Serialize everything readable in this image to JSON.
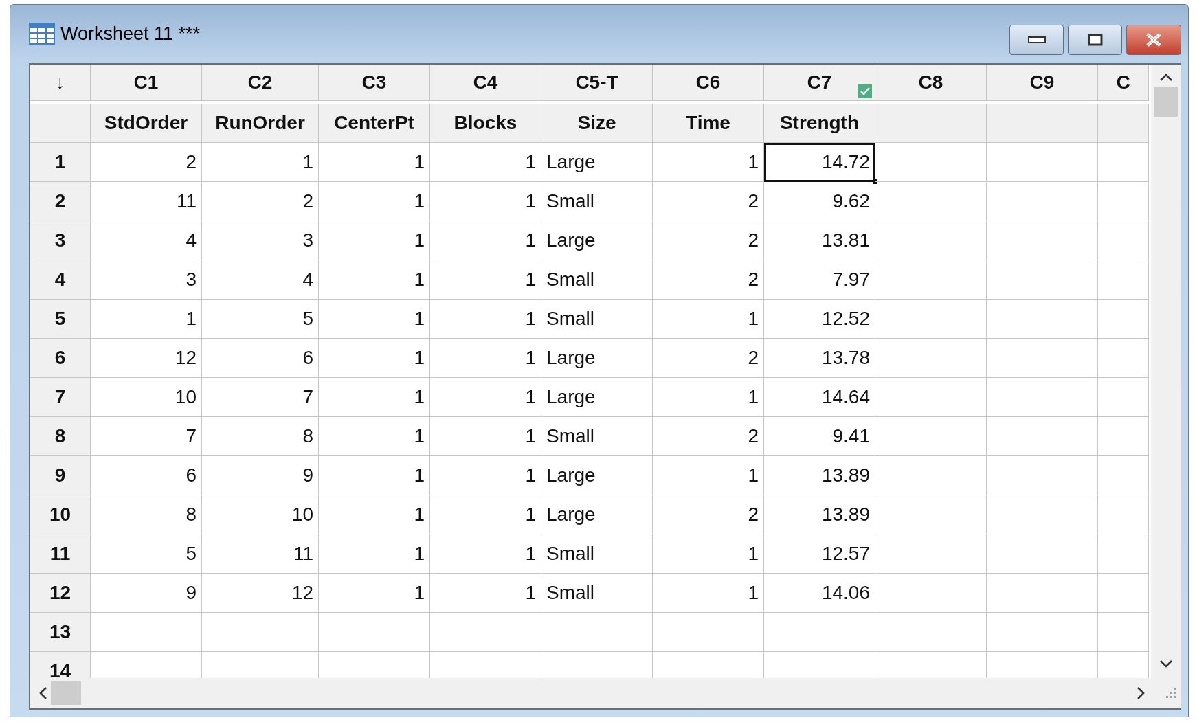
{
  "window": {
    "title": "Worksheet 11 ***"
  },
  "corner": "↓",
  "columns": [
    {
      "id": "C1",
      "name": "StdOrder",
      "kind": "numeric",
      "checked": false
    },
    {
      "id": "C2",
      "name": "RunOrder",
      "kind": "numeric",
      "checked": false
    },
    {
      "id": "C3",
      "name": "CenterPt",
      "kind": "numeric",
      "checked": false
    },
    {
      "id": "C4",
      "name": "Blocks",
      "kind": "numeric",
      "checked": false
    },
    {
      "id": "C5-T",
      "name": "Size",
      "kind": "text",
      "checked": false
    },
    {
      "id": "C6",
      "name": "Time",
      "kind": "numeric",
      "checked": false
    },
    {
      "id": "C7",
      "name": "Strength",
      "kind": "numeric",
      "checked": true
    },
    {
      "id": "C8",
      "kind": "numeric",
      "checked": false
    },
    {
      "id": "C9",
      "kind": "numeric",
      "checked": false
    },
    {
      "id": "C",
      "kind": "numeric",
      "checked": false
    }
  ],
  "rows": [
    {
      "number": "1",
      "cells": [
        {
          "value": "2",
          "selected": false
        },
        {
          "value": "1",
          "selected": false
        },
        {
          "value": "1",
          "selected": false
        },
        {
          "value": "1",
          "selected": false
        },
        {
          "value": "Large",
          "selected": false
        },
        {
          "value": "1",
          "selected": false
        },
        {
          "value": "14.72",
          "selected": true
        }
      ]
    },
    {
      "number": "2",
      "cells": [
        {
          "value": "11",
          "selected": false
        },
        {
          "value": "2",
          "selected": false
        },
        {
          "value": "1",
          "selected": false
        },
        {
          "value": "1",
          "selected": false
        },
        {
          "value": "Small",
          "selected": false
        },
        {
          "value": "2",
          "selected": false
        },
        {
          "value": "9.62",
          "selected": false
        }
      ]
    },
    {
      "number": "3",
      "cells": [
        {
          "value": "4",
          "selected": false
        },
        {
          "value": "3",
          "selected": false
        },
        {
          "value": "1",
          "selected": false
        },
        {
          "value": "1",
          "selected": false
        },
        {
          "value": "Large",
          "selected": false
        },
        {
          "value": "2",
          "selected": false
        },
        {
          "value": "13.81",
          "selected": false
        }
      ]
    },
    {
      "number": "4",
      "cells": [
        {
          "value": "3",
          "selected": false
        },
        {
          "value": "4",
          "selected": false
        },
        {
          "value": "1",
          "selected": false
        },
        {
          "value": "1",
          "selected": false
        },
        {
          "value": "Small",
          "selected": false
        },
        {
          "value": "2",
          "selected": false
        },
        {
          "value": "7.97",
          "selected": false
        }
      ]
    },
    {
      "number": "5",
      "cells": [
        {
          "value": "1",
          "selected": false
        },
        {
          "value": "5",
          "selected": false
        },
        {
          "value": "1",
          "selected": false
        },
        {
          "value": "1",
          "selected": false
        },
        {
          "value": "Small",
          "selected": false
        },
        {
          "value": "1",
          "selected": false
        },
        {
          "value": "12.52",
          "selected": false
        }
      ]
    },
    {
      "number": "6",
      "cells": [
        {
          "value": "12",
          "selected": false
        },
        {
          "value": "6",
          "selected": false
        },
        {
          "value": "1",
          "selected": false
        },
        {
          "value": "1",
          "selected": false
        },
        {
          "value": "Large",
          "selected": false
        },
        {
          "value": "2",
          "selected": false
        },
        {
          "value": "13.78",
          "selected": false
        }
      ]
    },
    {
      "number": "7",
      "cells": [
        {
          "value": "10",
          "selected": false
        },
        {
          "value": "7",
          "selected": false
        },
        {
          "value": "1",
          "selected": false
        },
        {
          "value": "1",
          "selected": false
        },
        {
          "value": "Large",
          "selected": false
        },
        {
          "value": "1",
          "selected": false
        },
        {
          "value": "14.64",
          "selected": false
        }
      ]
    },
    {
      "number": "8",
      "cells": [
        {
          "value": "7",
          "selected": false
        },
        {
          "value": "8",
          "selected": false
        },
        {
          "value": "1",
          "selected": false
        },
        {
          "value": "1",
          "selected": false
        },
        {
          "value": "Small",
          "selected": false
        },
        {
          "value": "2",
          "selected": false
        },
        {
          "value": "9.41",
          "selected": false
        }
      ]
    },
    {
      "number": "9",
      "cells": [
        {
          "value": "6",
          "selected": false
        },
        {
          "value": "9",
          "selected": false
        },
        {
          "value": "1",
          "selected": false
        },
        {
          "value": "1",
          "selected": false
        },
        {
          "value": "Large",
          "selected": false
        },
        {
          "value": "1",
          "selected": false
        },
        {
          "value": "13.89",
          "selected": false
        }
      ]
    },
    {
      "number": "10",
      "cells": [
        {
          "value": "8",
          "selected": false
        },
        {
          "value": "10",
          "selected": false
        },
        {
          "value": "1",
          "selected": false
        },
        {
          "value": "1",
          "selected": false
        },
        {
          "value": "Large",
          "selected": false
        },
        {
          "value": "2",
          "selected": false
        },
        {
          "value": "13.89",
          "selected": false
        }
      ]
    },
    {
      "number": "11",
      "cells": [
        {
          "value": "5",
          "selected": false
        },
        {
          "value": "11",
          "selected": false
        },
        {
          "value": "1",
          "selected": false
        },
        {
          "value": "1",
          "selected": false
        },
        {
          "value": "Small",
          "selected": false
        },
        {
          "value": "1",
          "selected": false
        },
        {
          "value": "12.57",
          "selected": false
        }
      ]
    },
    {
      "number": "12",
      "cells": [
        {
          "value": "9",
          "selected": false
        },
        {
          "value": "12",
          "selected": false
        },
        {
          "value": "1",
          "selected": false
        },
        {
          "value": "1",
          "selected": false
        },
        {
          "value": "Small",
          "selected": false
        },
        {
          "value": "1",
          "selected": false
        },
        {
          "value": "14.06",
          "selected": false
        }
      ]
    },
    {
      "number": "13"
    },
    {
      "number": "14"
    }
  ]
}
